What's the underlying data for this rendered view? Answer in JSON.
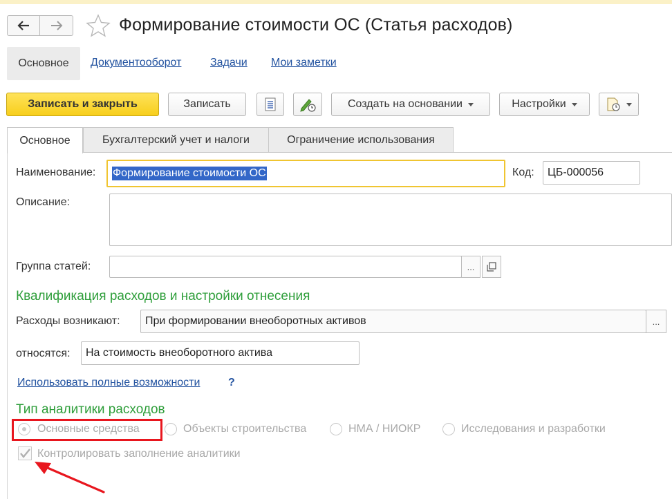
{
  "window": {
    "title": "Формирование стоимости ОС (Статья расходов)"
  },
  "section_nav": {
    "active": "Основное",
    "links": [
      "Документооборот",
      "Задачи",
      "Мои заметки"
    ]
  },
  "toolbar": {
    "save_close_label": "Записать и закрыть",
    "save_label": "Записать",
    "create_based_label": "Создать на основании",
    "settings_label": "Настройки"
  },
  "tabs": [
    "Основное",
    "Бухгалтерский учет и налоги",
    "Ограничение использования"
  ],
  "form": {
    "name_label": "Наименование:",
    "name_value": "Формирование стоимости ОС",
    "code_label": "Код:",
    "code_value": "ЦБ-000056",
    "description_label": "Описание:",
    "description_value": "",
    "group_label": "Группа статей:",
    "group_value": "",
    "group_select_btn": "...",
    "qualification_header": "Квалификация расходов и настройки отнесения",
    "expenses_arise_label": "Расходы возникают:",
    "expenses_arise_value": "При формировании внеоборотных активов",
    "expenses_arise_btn": "...",
    "relate_label": "относятся:",
    "relate_value": "На стоимость внеоборотного актива",
    "full_features_link": "Использовать полные возможности",
    "help_mark": "?",
    "analytics_header": "Тип аналитики расходов",
    "analytics_options": [
      "Основные средства",
      "Объекты строительства",
      "НМА / НИОКР",
      "Исследования и разработки"
    ],
    "analytics_selected": "Основные средства",
    "control_label": "Контролировать заполнение аналитики",
    "control_checked": true
  },
  "colors": {
    "primary_button": "#f7ce1c",
    "section_header": "#2e9e3a",
    "link": "#2353a0",
    "highlight_box": "#e8161e",
    "focus_border": "#f0c531"
  }
}
